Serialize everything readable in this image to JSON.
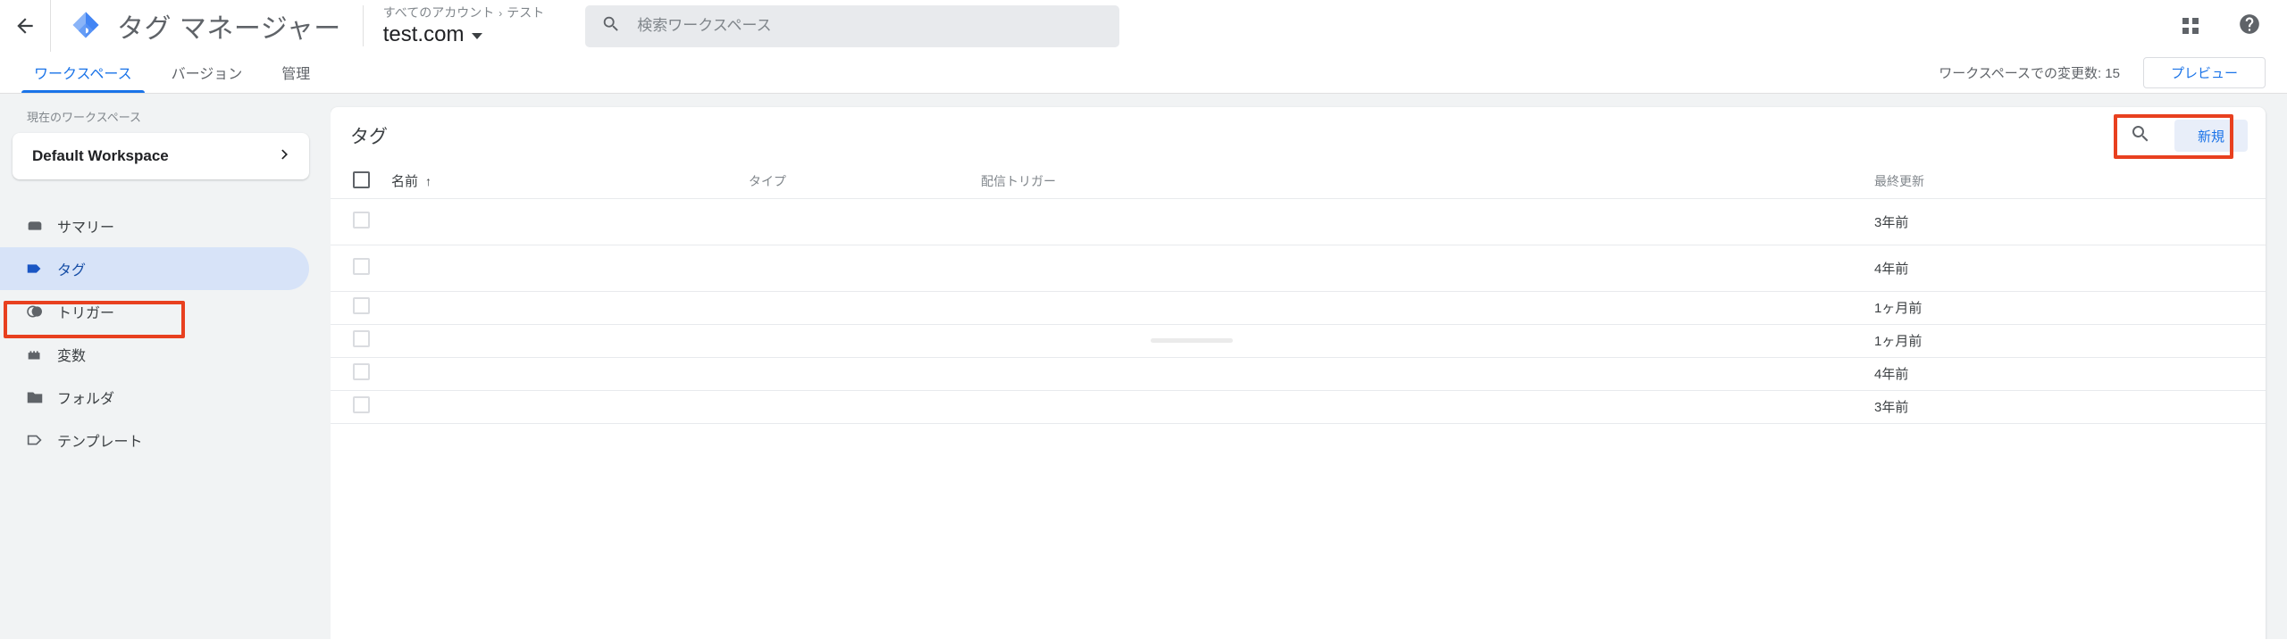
{
  "topbar": {
    "back_icon": "arrow-left-icon",
    "logo_icon": "tag-manager-logo",
    "title": "タグ マネージャー",
    "breadcrumb": "すべてのアカウント",
    "breadcrumb_sep": "›",
    "breadcrumb_last": "テスト",
    "account_name": "test.com",
    "search": {
      "icon": "search-icon",
      "placeholder": "検索ワークスペース",
      "value": ""
    },
    "apps_icon": "grid-apps-icon",
    "help_icon": "help-circle-icon"
  },
  "tabbar": {
    "tabs": [
      {
        "label": "ワークスペース",
        "active": true
      },
      {
        "label": "バージョン",
        "active": false
      },
      {
        "label": "管理",
        "active": false
      }
    ],
    "changes_text": "ワークスペースでの変更数: 15",
    "preview_label": "プレビュー"
  },
  "sidebar": {
    "workspace_label": "現在のワークスペース",
    "workspace_name": "Default Workspace",
    "workspace_chevron": "chevron-right-icon",
    "items": [
      {
        "label": "サマリー",
        "icon": "summary-icon",
        "selected": false
      },
      {
        "label": "タグ",
        "icon": "tag-icon",
        "selected": true
      },
      {
        "label": "トリガー",
        "icon": "trigger-icon",
        "selected": false
      },
      {
        "label": "変数",
        "icon": "variable-icon",
        "selected": false
      },
      {
        "label": "フォルダ",
        "icon": "folder-icon",
        "selected": false
      },
      {
        "label": "テンプレート",
        "icon": "template-icon",
        "selected": false
      }
    ]
  },
  "main": {
    "panel_title": "タグ",
    "search_icon": "search-icon",
    "new_button_label": "新規",
    "table": {
      "columns": [
        "名前",
        "タイプ",
        "配信トリガー",
        "最終更新"
      ],
      "sort_column": "名前",
      "sort_arrow": "↑",
      "rows": [
        {
          "name": "",
          "type": "",
          "trigger": "",
          "updated": "3年前"
        },
        {
          "name": "",
          "type": "",
          "trigger": "",
          "updated": "4年前"
        },
        {
          "name": "",
          "type": "",
          "trigger": "",
          "updated": "1ヶ月前"
        },
        {
          "name": "",
          "type": "",
          "trigger": "",
          "updated": "1ヶ月前"
        },
        {
          "name": "",
          "type": "",
          "trigger": "",
          "updated": "4年前"
        },
        {
          "name": "",
          "type": "",
          "trigger": "",
          "updated": "3年前"
        }
      ]
    }
  },
  "highlights": {
    "color": "#e8401f",
    "targets": [
      "sidebar-item-tag",
      "new-button"
    ]
  },
  "colors": {
    "accent_blue": "#1a73e8",
    "selected_bg": "#d7e3f8",
    "page_bg": "#f1f3f4",
    "text_primary": "#3c4043",
    "text_secondary": "#80868b",
    "highlight_red": "#e8401f"
  }
}
